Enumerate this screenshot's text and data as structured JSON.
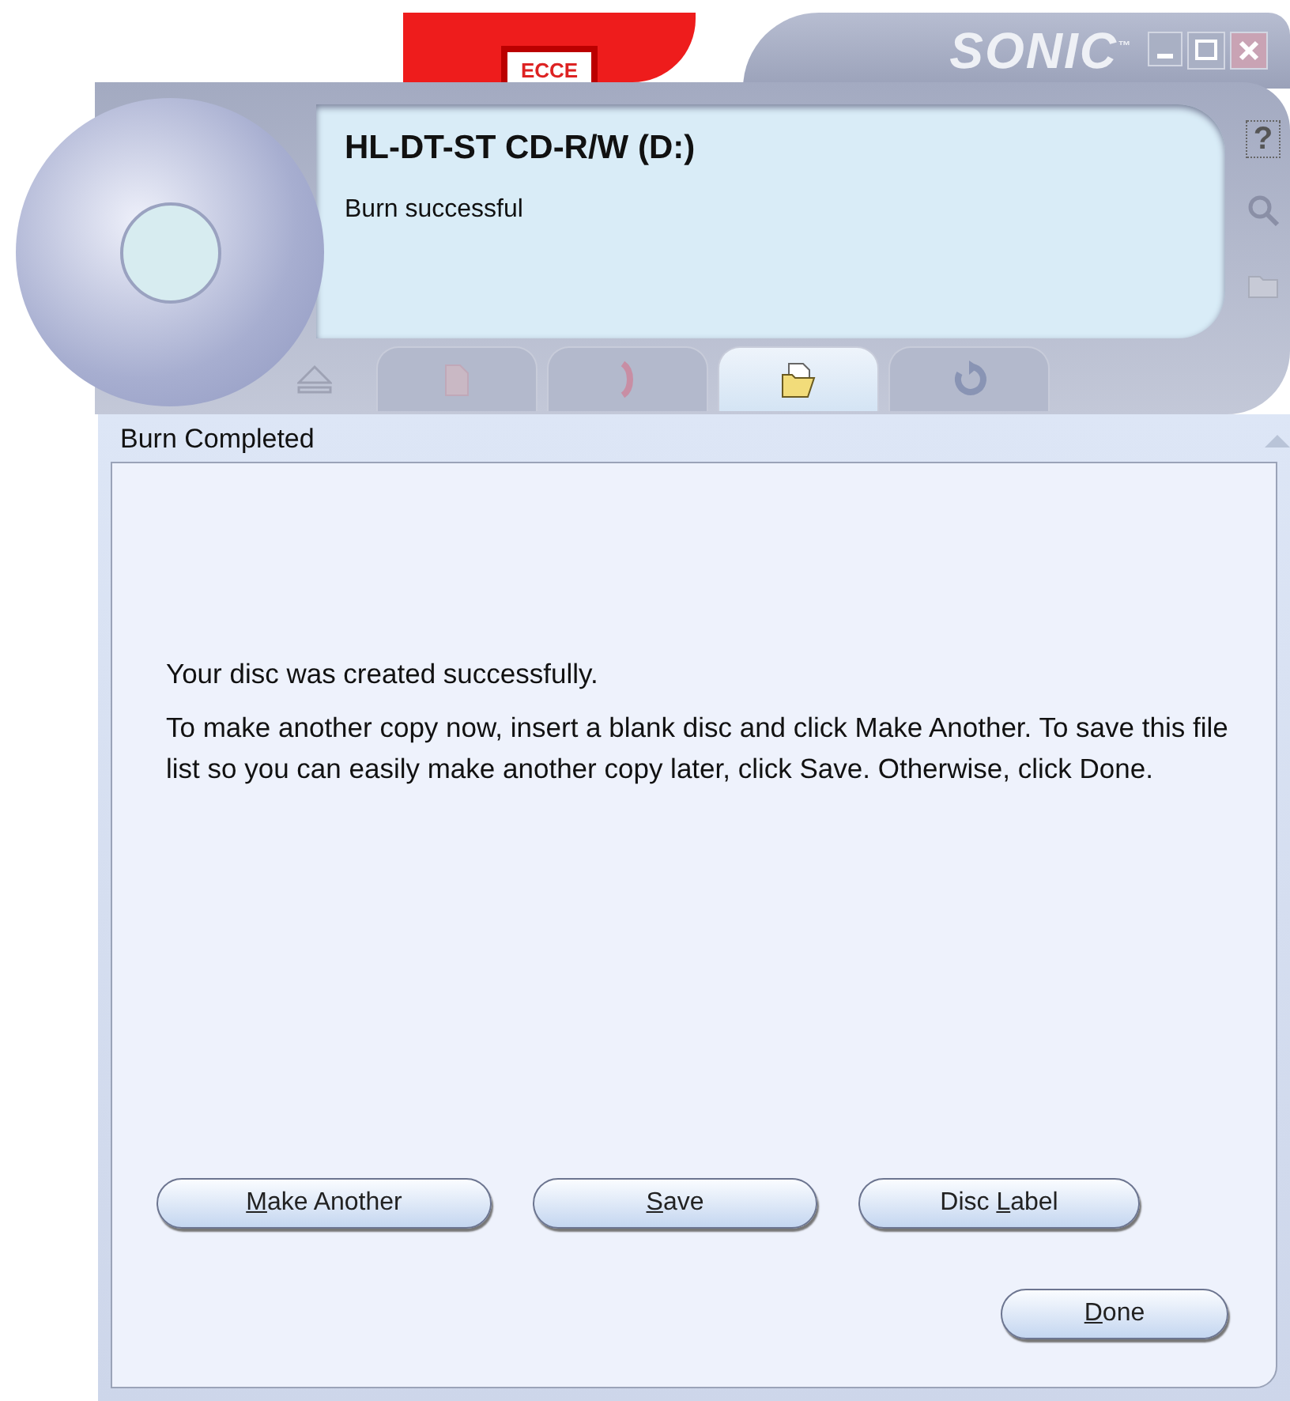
{
  "logo": {
    "text": "ECCE"
  },
  "brand": "SONIC$^{™}$",
  "window_controls": [
    {
      "kind": "minimize"
    },
    {
      "kind": "maximize"
    },
    {
      "kind": "close"
    }
  ],
  "device": {
    "name": "HL-DT-ST CD-R/W (D:)",
    "status": "Burn successful"
  },
  "side_tools": [
    {
      "kind": "help",
      "text": "?"
    },
    {
      "kind": "search"
    },
    {
      "kind": "folder"
    }
  ],
  "tabs": [
    {
      "kind": "document",
      "selected": false
    },
    {
      "kind": "microphone",
      "selected": false
    },
    {
      "kind": "folder",
      "selected": true
    },
    {
      "kind": "refresh",
      "selected": false
    }
  ],
  "panel": {
    "title": "Burn Completed",
    "messages": [
      "Your disc was created successfully.",
      "To make another copy now, insert a blank disc and click Make Another. To save this file list so you can easily make another copy later, click Save. Otherwise, click Done."
    ],
    "buttons": [
      {
        "key": "M",
        "after": "ake Another"
      },
      {
        "key": "S",
        "after": "ave"
      },
      {
        "before": "Disc ",
        "key": "L",
        "after": "abel"
      }
    ],
    "done_button": {
      "key": "D",
      "after": "one"
    }
  }
}
